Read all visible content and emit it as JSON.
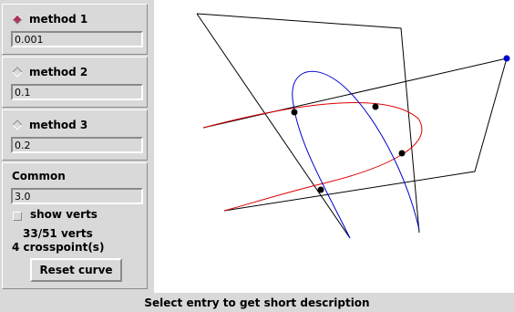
{
  "methods": [
    {
      "label": "method 1",
      "value": "0.001",
      "selected": true
    },
    {
      "label": "method 2",
      "value": "0.1",
      "selected": false
    },
    {
      "label": "method 3",
      "value": "0.2",
      "selected": false
    }
  ],
  "common": {
    "label": "Common",
    "value": "3.0",
    "show_verts_label": "show verts",
    "show_verts_checked": false,
    "verts_info": "33/51 verts",
    "crosspoints_info": "4 crosspoint(s)",
    "reset_label": "Reset curve"
  },
  "status": {
    "text": "Select entry to get short description"
  },
  "colors": {
    "curve_red": "#dd0000",
    "curve_blue": "#0000cc",
    "control_lines": "#000000",
    "selected_radio": "#b03060"
  }
}
